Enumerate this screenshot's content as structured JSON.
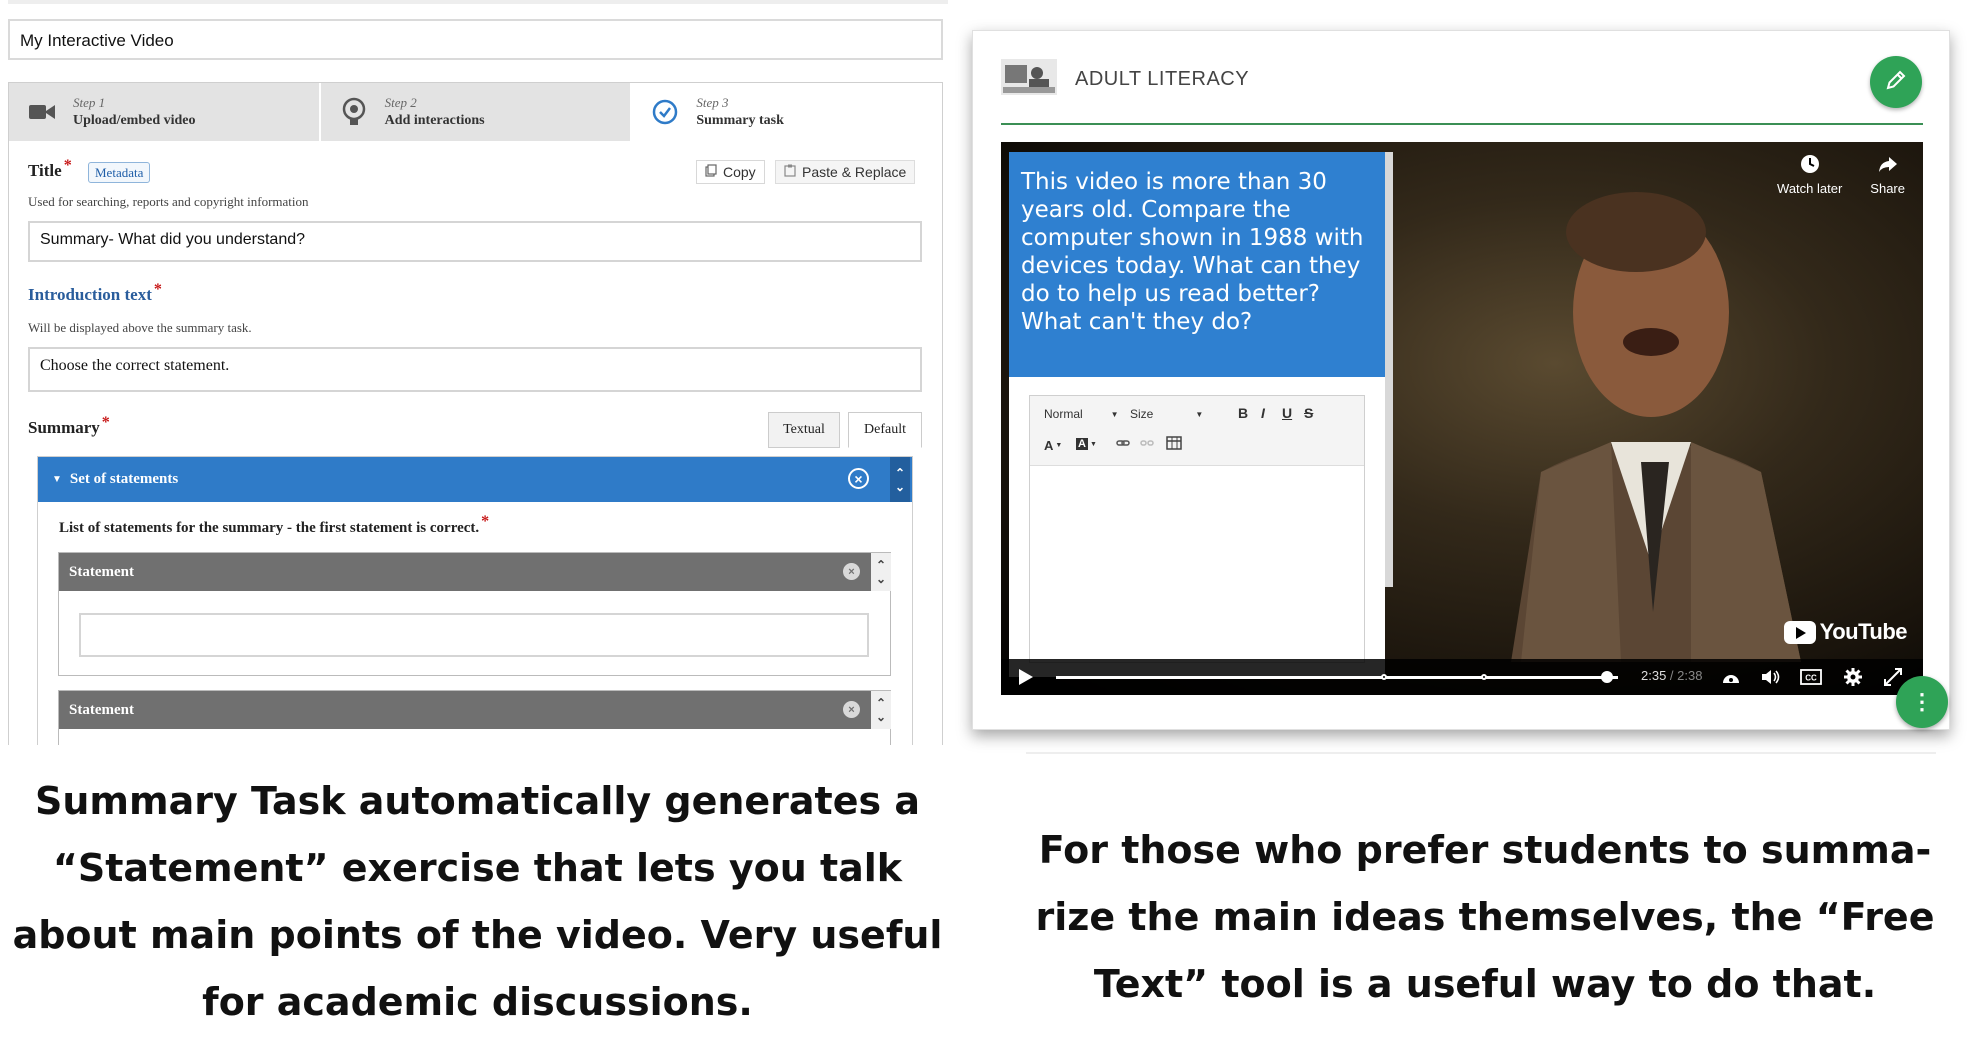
{
  "editor": {
    "video_title": "My Interactive Video",
    "steps": [
      {
        "number": "Step 1",
        "name": "Upload/embed video",
        "icon": "video-camera-icon"
      },
      {
        "number": "Step 2",
        "name": "Add interactions",
        "icon": "interactions-icon"
      },
      {
        "number": "Step 3",
        "name": "Summary task",
        "icon": "check-circle-icon"
      }
    ],
    "title_label": "Title",
    "metadata_label": "Metadata",
    "copy_label": "Copy",
    "paste_label": "Paste & Replace",
    "title_desc": "Used for searching, reports and copyright information",
    "title_value": "Summary- What did you understand?",
    "intro_label": "Introduction text",
    "intro_desc": "Will be displayed above the summary task.",
    "intro_value": "Choose the correct statement.",
    "summary_label": "Summary",
    "mode_textual": "Textual",
    "mode_default": "Default",
    "set_label": "Set of statements",
    "list_label": "List of statements for the summary - the first statement is correct.",
    "statement_label": "Statement",
    "required_mark": "*",
    "accent_color": "#2f7bc8"
  },
  "player": {
    "header_title": "ADULT LITERACY",
    "question_text": "This video is more than 30 years old. Compare the computer shown in 1988 with devices today. What can they do to help us read better? What can't they do?",
    "watch_later": "Watch later",
    "share": "Share",
    "youtube": "YouTube",
    "time_current": "2:35",
    "time_total": "2:38",
    "time_sep": " / ",
    "progress_fraction": 0.98,
    "rte": {
      "format": "Normal",
      "size": "Size",
      "bold": "B",
      "italic": "I",
      "underline": "U",
      "strike": "S"
    },
    "accent_color": "#2fa357"
  },
  "captions": {
    "left": "Summary Task automatically generates a “Statement” exercise that lets you talk about main points of the video. Very useful for academic discussions.",
    "right": "For those who prefer students to summa- rize the main ideas themselves, the “Free Text” tool is a useful way to do that."
  }
}
